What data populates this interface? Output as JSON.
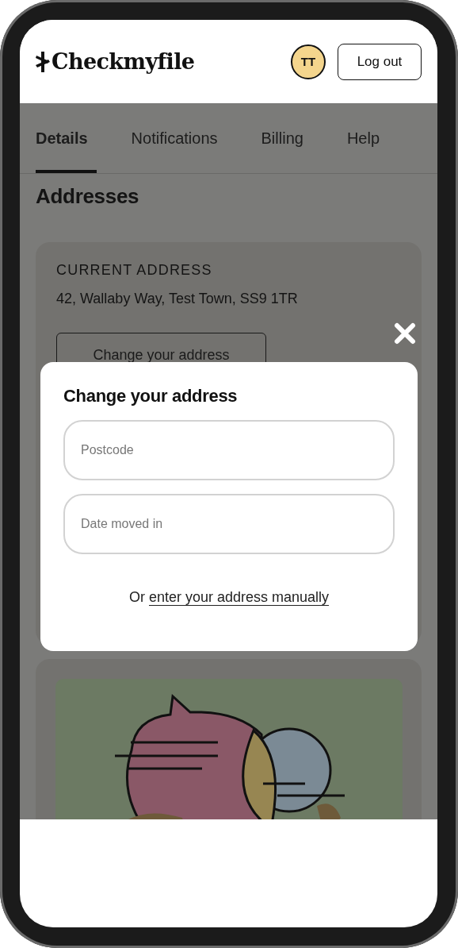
{
  "header": {
    "logo": "Checkmyfile",
    "avatar_initials": "TT",
    "logout_button": "Log out"
  },
  "tabs": [
    {
      "label": "Details",
      "selected": true
    },
    {
      "label": "Notifications",
      "selected": false
    },
    {
      "label": "Billing",
      "selected": false
    },
    {
      "label": "Help",
      "selected": false
    }
  ],
  "page_title": "Addresses",
  "current_address": {
    "label": "CURRENT ADDRESS",
    "address": "42, Wallaby Way, Test Town, SS9 1TR",
    "change_button": "Change your address"
  },
  "modal": {
    "title": "Change your address",
    "fields": [
      {
        "placeholder": "Postcode"
      },
      {
        "placeholder": "Date moved in"
      }
    ],
    "manual_prefix": "Or",
    "manual_link": "enter your address manually"
  }
}
